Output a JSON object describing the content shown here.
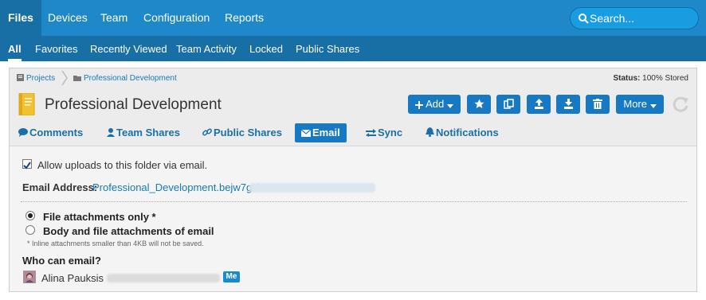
{
  "topnav": {
    "items": [
      "Files",
      "Devices",
      "Team",
      "Configuration",
      "Reports"
    ],
    "search_placeholder": "Search..."
  },
  "subnav": {
    "items": [
      "All",
      "Favorites",
      "Recently Viewed",
      "Team Activity",
      "Locked",
      "Public Shares"
    ]
  },
  "breadcrumb": [
    "Projects",
    "Professional Development"
  ],
  "status": {
    "label": "Status:",
    "value": "100% Stored"
  },
  "folder": {
    "title": "Professional Development"
  },
  "toolbar": {
    "add_label": "Add",
    "more_label": "More"
  },
  "tabs": [
    "Comments",
    "Team Shares",
    "Public Shares",
    "Email",
    "Sync",
    "Notifications"
  ],
  "email_settings": {
    "allow_uploads_label": "Allow uploads to this folder via email.",
    "address_label": "Email Address:",
    "address_value": "Professional_Development.bejw7g-1",
    "option_attachments_only": "File attachments only *",
    "option_body_and_attachments": "Body and file attachments of email",
    "note": "* Inline attachments smaller than 4KB will not be saved.",
    "who_label": "Who can email?",
    "user_name": "Alina Pauksis",
    "me_badge": "Me"
  },
  "colors": {
    "topnav_bg": "#1e88c8",
    "subnav_bg": "#176fa6",
    "button_bg": "#1779c3",
    "link": "#1779b9"
  }
}
